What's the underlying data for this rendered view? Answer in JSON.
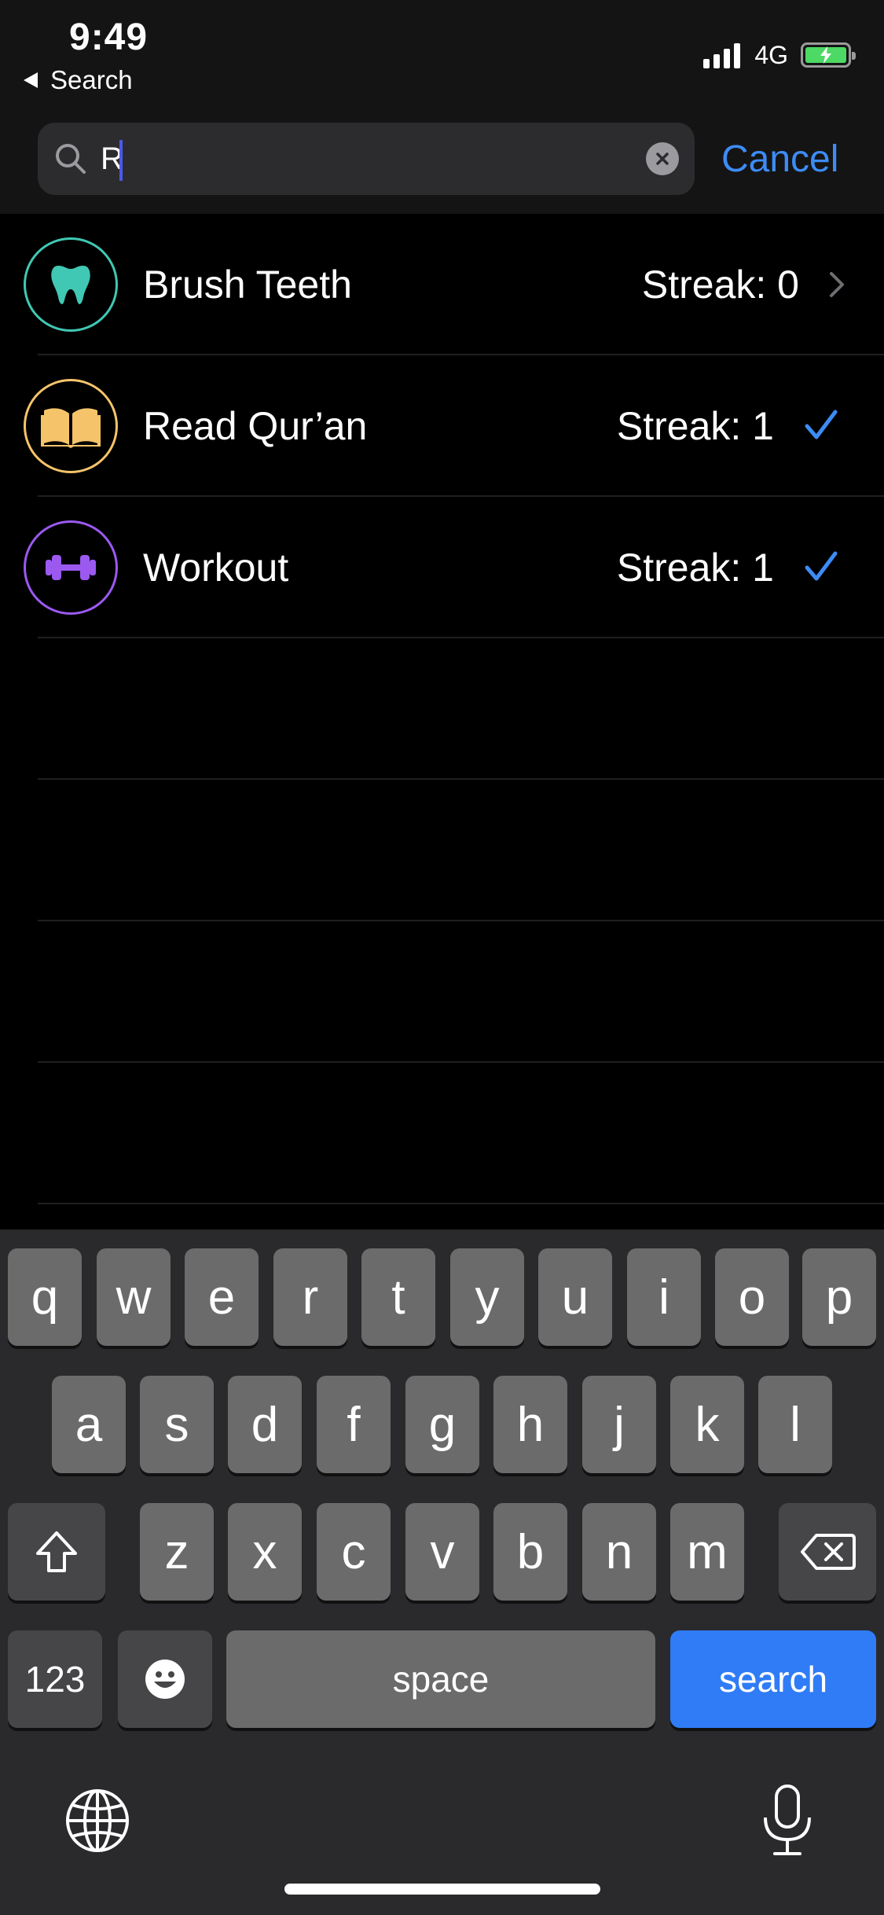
{
  "status_bar": {
    "time": "9:49",
    "back_label": "Search",
    "network": "4G",
    "signal_bars": 4,
    "battery_charging": true
  },
  "search": {
    "query": "R",
    "cancel_label": "Cancel"
  },
  "habits": [
    {
      "name": "Brush Teeth",
      "streak": "Streak: 0",
      "accessory": "chevron-right",
      "icon": "tooth-icon",
      "color": "#40c8b4"
    },
    {
      "name": "Read Qur’an",
      "streak": "Streak: 1",
      "accessory": "checkmark",
      "icon": "book-icon",
      "color": "#f5c46a"
    },
    {
      "name": "Workout",
      "streak": "Streak: 1",
      "accessory": "checkmark",
      "icon": "dumbbell-icon",
      "color": "#9b59f0"
    }
  ],
  "colors": {
    "accent": "#3d8cf5",
    "search_key": "#2f7cf6"
  },
  "keyboard": {
    "row1": [
      "q",
      "w",
      "e",
      "r",
      "t",
      "y",
      "u",
      "i",
      "o",
      "p"
    ],
    "row2": [
      "a",
      "s",
      "d",
      "f",
      "g",
      "h",
      "j",
      "k",
      "l"
    ],
    "row3": [
      "z",
      "x",
      "c",
      "v",
      "b",
      "n",
      "m"
    ],
    "numbers_label": "123",
    "space_label": "space",
    "search_label": "search"
  }
}
